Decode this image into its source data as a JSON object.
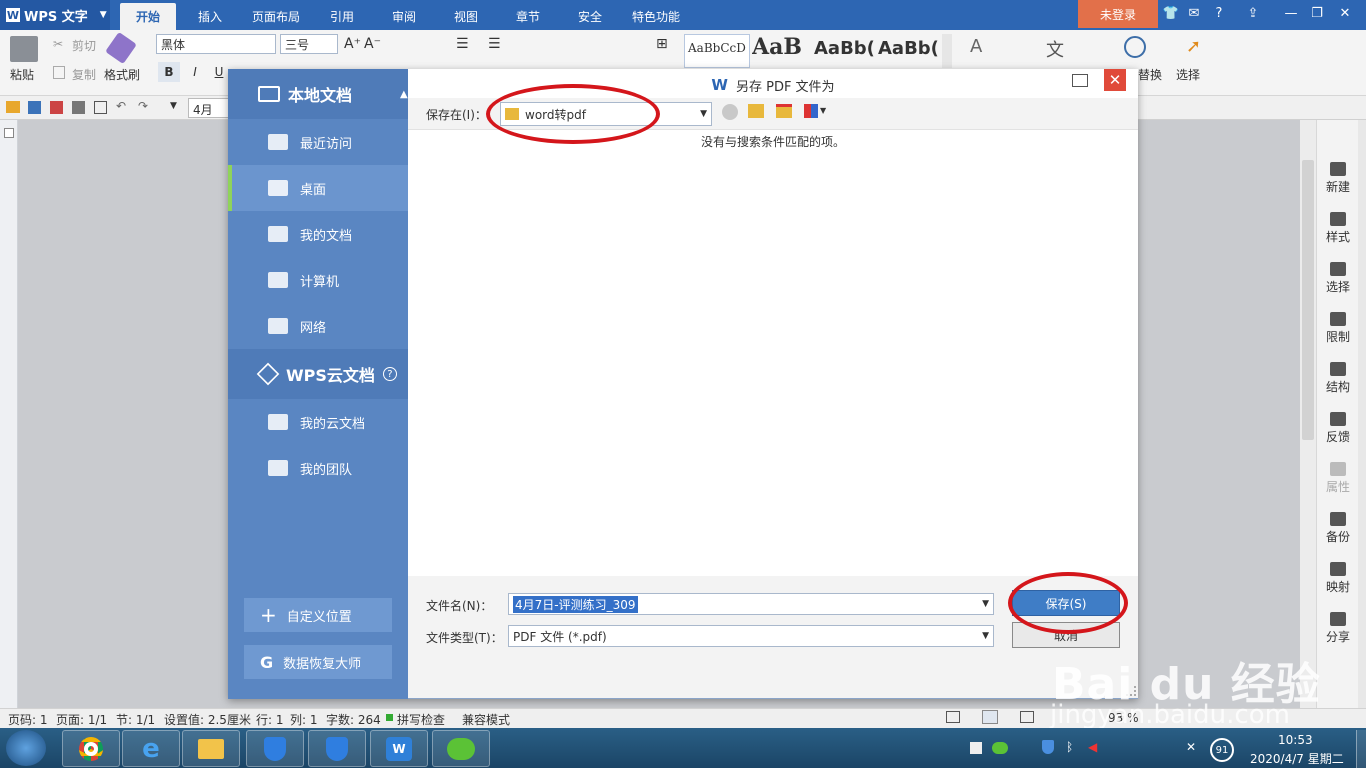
{
  "app": {
    "title": "WPS 文字",
    "logo": "W"
  },
  "tabs": [
    "开始",
    "插入",
    "页面布局",
    "引用",
    "审阅",
    "视图",
    "章节",
    "安全",
    "特色功能"
  ],
  "active_tab": "开始",
  "login": "未登录",
  "titlebar_icons": [
    "shirt-icon",
    "chat-icon",
    "help-icon",
    "pin-icon",
    "minimize-icon",
    "restore-icon",
    "close-icon"
  ],
  "ribbon": {
    "paste": "粘贴",
    "cut": "剪切",
    "copy": "复制",
    "format_painter": "格式刷",
    "font": "黑体",
    "font_size": "三号",
    "bold": "B",
    "italic": "I",
    "underline": "U",
    "styles": [
      "AaBbCcD",
      "AaB",
      "AaBb(",
      "AaBb("
    ],
    "replace": "替换",
    "select": "选择"
  },
  "quick": {
    "doc_tab": "4月"
  },
  "dialog": {
    "title": "另存 PDF 文件为",
    "sidebar": {
      "local_header": "本地文档",
      "local_items": [
        "最近访问",
        "桌面",
        "我的文档",
        "计算机",
        "网络"
      ],
      "selected": "桌面",
      "cloud_header": "WPS云文档",
      "cloud_items": [
        "我的云文档",
        "我的团队"
      ],
      "custom_location": "自定义位置",
      "recovery": "数据恢复大师"
    },
    "save_in_label": "保存在(I)：",
    "save_in_value": "word转pdf",
    "empty_message": "没有与搜索条件匹配的项。",
    "filename_label": "文件名(N)：",
    "filename_value": "4月7日-评测练习_309",
    "filetype_label": "文件类型(T)：",
    "filetype_value": "PDF 文件 (*.pdf)",
    "save_button": "保存(S)",
    "cancel_button": "取消"
  },
  "right_panel": [
    "新建",
    "样式",
    "选择",
    "限制",
    "结构",
    "反馈",
    "属性",
    "备份",
    "映射",
    "分享"
  ],
  "status": {
    "page": "页码: 1",
    "pages": "页面: 1/1",
    "section": "节: 1/1",
    "setting": "设置值: 2.5厘米",
    "row": "行: 1",
    "col": "列: 1",
    "words": "字数: 264",
    "spell": "拼写检查",
    "compat": "兼容模式",
    "zoom": "93 %"
  },
  "taskbar": {
    "apps": [
      "chrome-icon",
      "ie-icon",
      "explorer-icon",
      "shield-icon",
      "shield-icon-2",
      "wps-icon",
      "wechat-icon"
    ],
    "time": "10:53",
    "date": "2020/4/7 星期二",
    "badge": "91"
  },
  "watermark": {
    "brand": "Bai du 经验",
    "url": "jingyan.baidu.com"
  },
  "colors": {
    "accent": "#2d66b3",
    "dialog_side": "#5a86c2",
    "annotation": "#d4161b",
    "login": "#e2704a"
  }
}
